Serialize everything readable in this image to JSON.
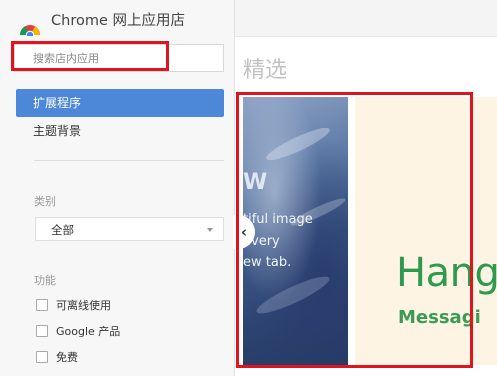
{
  "store": {
    "title": "Chrome 网上应用店"
  },
  "search": {
    "placeholder": "搜索店内应用"
  },
  "nav": {
    "items": [
      {
        "label": "扩展程序"
      },
      {
        "label": "主题背景"
      }
    ]
  },
  "filters": {
    "category_label": "类别",
    "category_value": "全部",
    "features_label": "功能",
    "features": [
      {
        "label": "可离线使用"
      },
      {
        "label": "Google 产品"
      },
      {
        "label": "免费"
      }
    ]
  },
  "main": {
    "section_title": "精选",
    "slides": [
      {
        "big": "W",
        "lines": [
          "tiful image",
          "every",
          "ew tab."
        ]
      },
      {
        "title": "Hang",
        "subtitle": "Messagi"
      }
    ],
    "prev_glyph": "‹"
  },
  "colors": {
    "active_nav": "#4d88d8",
    "highlight_red": "#e0141e",
    "hangouts_green": "#2f9a4f"
  },
  "icons": {
    "logo": "chrome-logo-icon",
    "select_arrow": "caret-down-icon",
    "prev": "chevron-left-icon"
  }
}
